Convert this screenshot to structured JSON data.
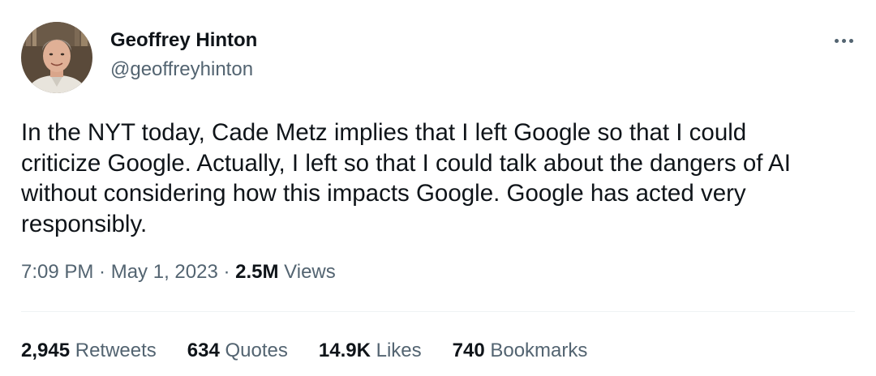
{
  "author": {
    "display_name": "Geoffrey Hinton",
    "handle": "@geoffreyhinton",
    "avatar_icon": "person-photo-icon"
  },
  "more_icon": "more-horizontal-icon",
  "tweet": {
    "lines": [
      "In the NYT today, Cade Metz implies that I left Google so that I could",
      "criticize Google. Actually, I left so that I could talk about the dangers of AI",
      "without considering how this impacts Google. Google has acted very",
      "responsibly."
    ]
  },
  "meta": {
    "time": "7:09 PM",
    "separator": " · ",
    "date": "May 1, 2023",
    "views_count": "2.5M",
    "views_label": " Views"
  },
  "stats": {
    "retweets": {
      "count": "2,945",
      "label": " Retweets"
    },
    "quotes": {
      "count": "634",
      "label": " Quotes"
    },
    "likes": {
      "count": "14.9K",
      "label": " Likes"
    },
    "bookmarks": {
      "count": "740",
      "label": " Bookmarks"
    }
  },
  "colors": {
    "primary_text": "#0f1419",
    "secondary_text": "#536471",
    "divider": "#eff3f4"
  }
}
